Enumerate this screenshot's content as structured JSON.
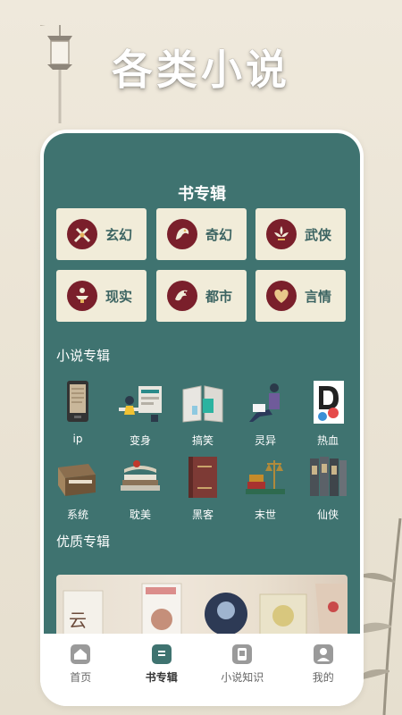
{
  "headline": "各类小说",
  "book_section": {
    "title": "书专辑",
    "genres": [
      {
        "label": "玄幻",
        "icon": "swords-icon"
      },
      {
        "label": "奇幻",
        "icon": "dragon-icon"
      },
      {
        "label": "武侠",
        "icon": "fleur-icon"
      },
      {
        "label": "现实",
        "icon": "lamp-icon"
      },
      {
        "label": "都市",
        "icon": "city-dragon-icon"
      },
      {
        "label": "言情",
        "icon": "heart-icon"
      }
    ]
  },
  "novel_section": {
    "title": "小说专辑",
    "items": [
      {
        "label": "ip",
        "icon": "ereader-icon"
      },
      {
        "label": "变身",
        "icon": "desk-illustration-icon"
      },
      {
        "label": "搞笑",
        "icon": "open-book-icon"
      },
      {
        "label": "灵异",
        "icon": "sitting-person-icon"
      },
      {
        "label": "热血",
        "icon": "letter-d-icon"
      },
      {
        "label": "系统",
        "icon": "book-box-icon"
      },
      {
        "label": "耽美",
        "icon": "scroll-books-icon"
      },
      {
        "label": "黑客",
        "icon": "red-book-icon"
      },
      {
        "label": "末世",
        "icon": "scale-books-icon"
      },
      {
        "label": "仙侠",
        "icon": "book-spines-icon"
      }
    ]
  },
  "quality_section": {
    "title": "优质专辑"
  },
  "tabbar": {
    "tabs": [
      {
        "label": "首页",
        "icon": "home-icon",
        "active": false
      },
      {
        "label": "书专辑",
        "icon": "book-list-icon",
        "active": true
      },
      {
        "label": "小说知识",
        "icon": "knowledge-icon",
        "active": false
      },
      {
        "label": "我的",
        "icon": "profile-icon",
        "active": false
      }
    ]
  },
  "colors": {
    "teal": "#3f7370",
    "card": "#f1ecd9",
    "maroon": "#7a1f2b"
  }
}
